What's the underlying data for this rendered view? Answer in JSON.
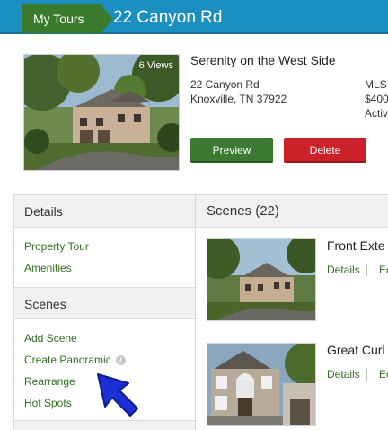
{
  "header": {
    "breadcrumb": "My Tours",
    "title": "22 Canyon Rd"
  },
  "property": {
    "views": "6 Views",
    "name": "Serenity on the West Side",
    "address_line1": "22 Canyon Rd",
    "address_line2": "Knoxville, TN 37922",
    "meta_line1": "MLS",
    "meta_line2": "$400",
    "meta_line3": "Activ",
    "preview_label": "Preview",
    "delete_label": "Delete"
  },
  "sidebar": {
    "details_title": "Details",
    "details_links": [
      "Property Tour",
      "Amenities"
    ],
    "scenes_title": "Scenes",
    "scenes_links": [
      "Add Scene",
      "Create Panoramic",
      "Rearrange",
      "Hot Spots"
    ]
  },
  "scenes": {
    "title": "Scenes (22)",
    "items": [
      {
        "title": "Front Exte",
        "details_label": "Details",
        "edit_label": "Ec"
      },
      {
        "title": "Great Curl",
        "details_label": "Details",
        "edit_label": "Ec"
      }
    ]
  },
  "icons": {
    "info": "info-icon",
    "cursor": "pointer-cursor-icon"
  },
  "colors": {
    "header_blue": "#1b8fc0",
    "breadcrumb_green": "#3a7a2c",
    "preview_green": "#3c7a31",
    "delete_red": "#cc2128",
    "link_green": "#2f6f1f"
  }
}
